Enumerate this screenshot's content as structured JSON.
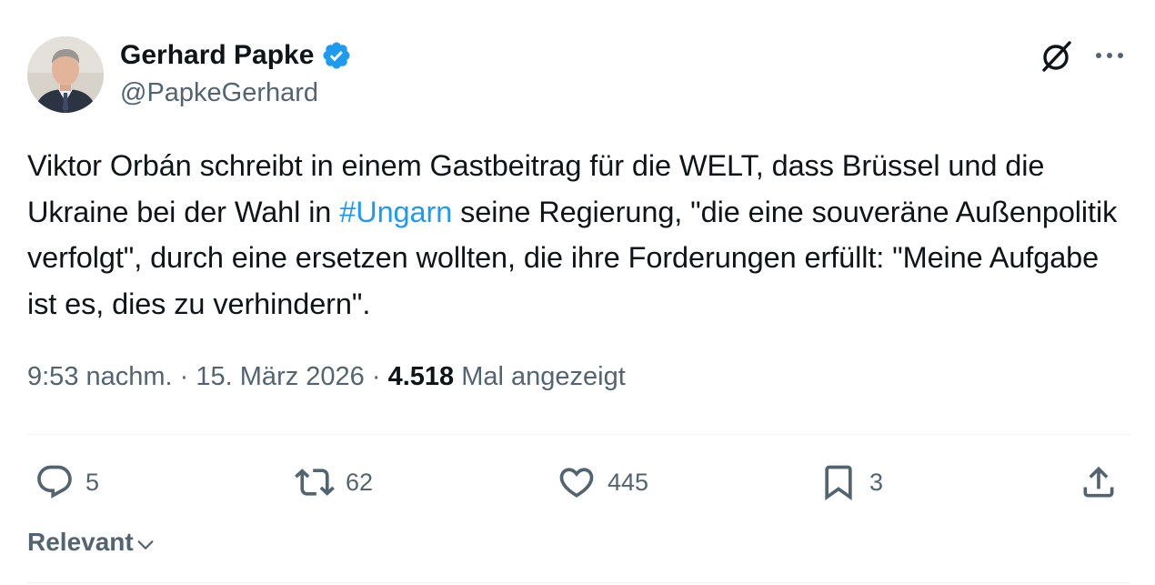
{
  "author": {
    "display_name": "Gerhard Papke",
    "handle": "@PapkeGerhard",
    "verified": true,
    "verified_color": "#1d9bf0"
  },
  "tweet": {
    "text_part1": "Viktor Orbán schreibt in einem Gastbeitrag für die WELT, dass Brüssel und die Ukraine bei der Wahl in ",
    "hashtag": "#Ungarn",
    "text_part2": " seine Regierung, \"die eine souveräne Außenpolitik verfolgt\", durch eine ersetzen wollten, die ihre Forderungen erfüllt: \"Meine Aufgabe ist es, dies zu verhindern\"."
  },
  "meta": {
    "time": "9:53 nachm.",
    "separator": "·",
    "date": "15. März 2026",
    "views_count": "4.518",
    "views_label": "Mal angezeigt"
  },
  "actions": {
    "replies": "5",
    "reposts": "62",
    "likes": "445",
    "bookmarks": "3"
  },
  "sort": {
    "label": "Relevant"
  },
  "colors": {
    "text": "#0f1419",
    "secondary": "#536471",
    "link": "#1d9bf0",
    "divider": "#eff3f4"
  },
  "icons": [
    "verified-badge-icon",
    "grok-icon",
    "more-icon",
    "reply-icon",
    "repost-icon",
    "like-icon",
    "bookmark-icon",
    "share-icon",
    "chevron-down-icon"
  ]
}
